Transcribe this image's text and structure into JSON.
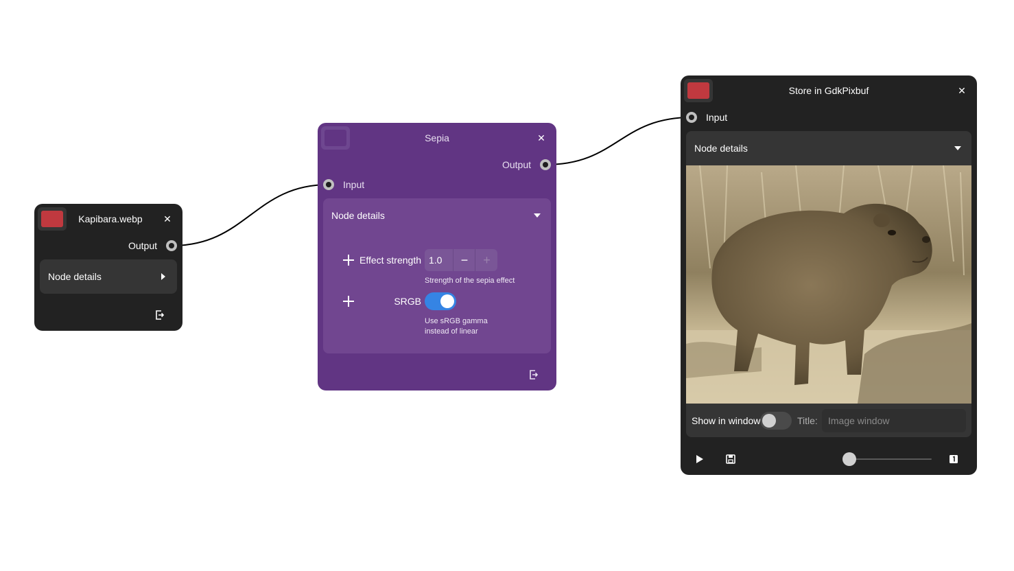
{
  "nodes": {
    "source": {
      "title": "Kapibara.webp",
      "swatch_color": "#c0393f",
      "output_label": "Output",
      "details_label": "Node details",
      "details_expanded": false
    },
    "sepia": {
      "title": "Sepia",
      "background": "#613583",
      "output_label": "Output",
      "input_label": "Input",
      "details_label": "Node details",
      "details_expanded": true,
      "params": {
        "effect_strength": {
          "label": "Effect strength",
          "value": "1.0",
          "description": "Strength of the sepia effect"
        },
        "srgb": {
          "label": "SRGB",
          "enabled": true,
          "description_line1": "Use sRGB gamma",
          "description_line2": "instead of linear"
        }
      }
    },
    "store": {
      "title": "Store in GdkPixbuf",
      "swatch_color": "#c0393f",
      "input_label": "Input",
      "details_label": "Node details",
      "details_expanded": true,
      "show_in_window_label": "Show in window",
      "show_in_window_enabled": false,
      "title_label": "Title:",
      "title_placeholder": "Image window",
      "title_value": "",
      "slider_value": 0
    }
  },
  "icons": {
    "close": "close-icon",
    "expand": "chevron-down-icon",
    "collapsed": "chevron-right-icon",
    "export": "export-icon",
    "play": "play-icon",
    "save": "save-icon",
    "zoom_reset": "zoom-1-to-1-icon"
  },
  "colors": {
    "dark_node": "#222222",
    "purple_node": "#613583",
    "toggle_on": "#3584e4",
    "accent_red": "#c0393f"
  }
}
